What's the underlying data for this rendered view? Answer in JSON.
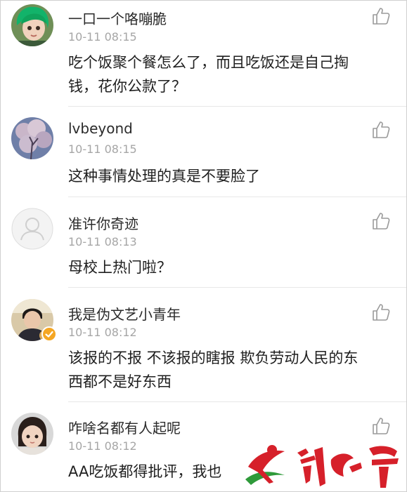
{
  "comments": [
    {
      "username": "一口一个咯嘣脆",
      "time": "10-11 08:15",
      "text_lines": [
        "吃个饭聚个餐怎么了，而且吃饭还是自己掏",
        "钱，花你公款了？"
      ],
      "avatar_icon": "avatar-green-hair"
    },
    {
      "username": "lvbeyond",
      "time": "10-11 08:15",
      "text_lines": [
        "这种事情处理的真是不要脸了"
      ],
      "avatar_icon": "avatar-blossom-tree"
    },
    {
      "username": "准许你奇迹",
      "time": "10-11 08:13",
      "text_lines": [
        "母校上热门啦？"
      ],
      "avatar_icon": "avatar-default"
    },
    {
      "username": "我是伪文艺小青年",
      "time": "10-11 08:12",
      "text_lines": [
        "该报的不报 不该报的瞎报 欺负劳动人民的东",
        "西都不是好东西"
      ],
      "avatar_icon": "avatar-boy-photo",
      "verified": true
    },
    {
      "username": "咋啥名都有人起呢",
      "time": "10-11 08:12",
      "text_lines": [
        "AA吃饭都得批评，我也"
      ],
      "avatar_icon": "avatar-girl-photo"
    }
  ],
  "colors": {
    "username": "#2b2b2b",
    "time": "#a6a6a6",
    "text": "#1f1f1f",
    "logo_red": "#d6202a",
    "logo_green": "#2f9a3a"
  },
  "icons": {
    "like": "thumbs-up-icon",
    "badge": "verified-badge-icon"
  }
}
